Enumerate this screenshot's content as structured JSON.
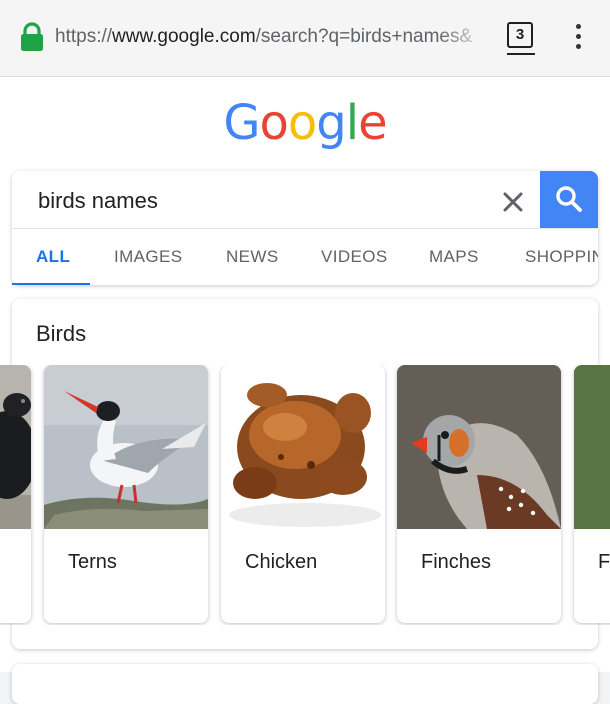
{
  "browser": {
    "url_scheme": "https://",
    "url_host": "www.google.com",
    "url_path": "/search?q=birds+names&",
    "tab_count": "3",
    "lock_color": "#1ea446"
  },
  "logo": [
    "G",
    "o",
    "o",
    "g",
    "l",
    "e"
  ],
  "search": {
    "query": "birds names",
    "accent": "#4285f4"
  },
  "tabs": [
    "ALL",
    "IMAGES",
    "NEWS",
    "VIDEOS",
    "MAPS",
    "SHOPPIN"
  ],
  "birds": {
    "title": "Birds",
    "items": [
      {
        "label": ""
      },
      {
        "label": "Terns"
      },
      {
        "label": "Chicken"
      },
      {
        "label": "Finches"
      },
      {
        "label": "F"
      }
    ]
  }
}
